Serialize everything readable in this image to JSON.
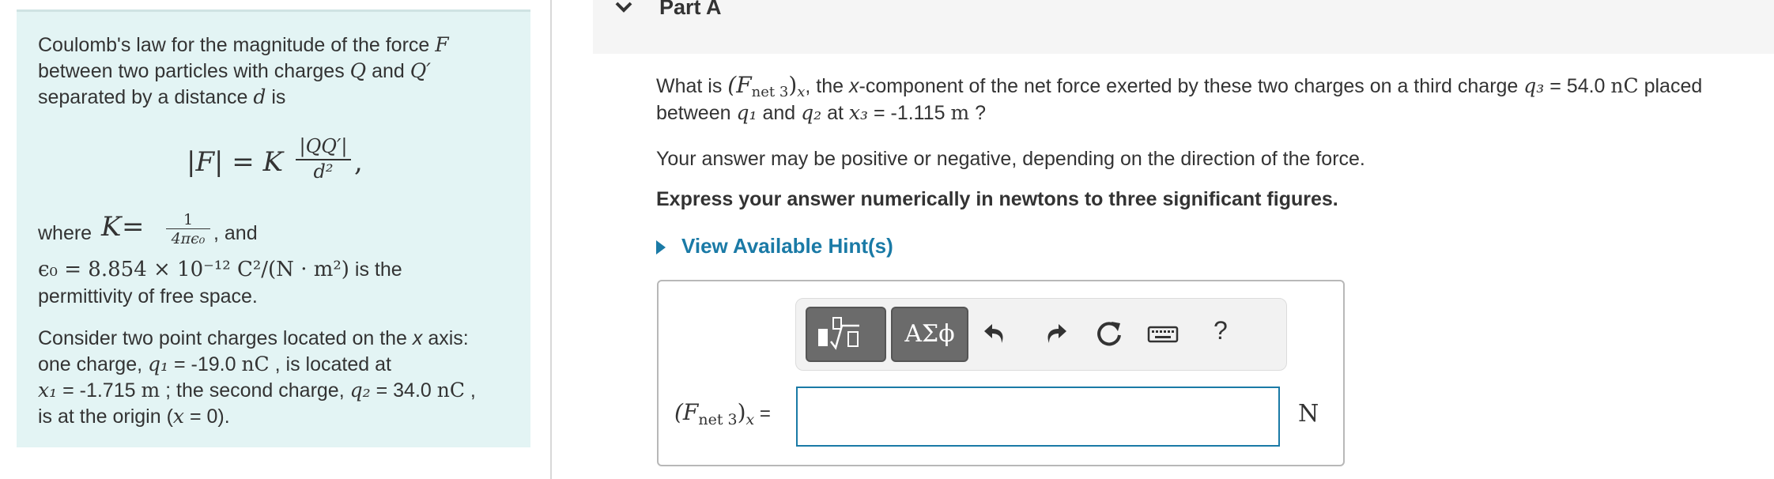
{
  "info": {
    "intro_1": "Coulomb's law for the magnitude of the force ",
    "intro_F": "F",
    "intro_2": "between two particles with charges ",
    "intro_Q": "Q",
    "intro_and": " and ",
    "intro_Qp": "Q′",
    "intro_3": "separated by a distance ",
    "intro_d": "d",
    "intro_is": " is",
    "formula_lhs": "|F| = K",
    "formula_num": "|QQ′|",
    "formula_den": "d²",
    "formula_comma": ",",
    "where": "where ",
    "K_sym": "K",
    "K_eq": " = ",
    "K_num": "1",
    "K_den": "4πϵ₀",
    "K_and": ", and",
    "eps_expr": "ϵ₀ = 8.854 × 10⁻¹² C²/(N · m²)",
    "eps_tail": " is the",
    "permittivity": "permittivity of free space.",
    "consider_1": "Consider two point charges located on the ",
    "consider_x": "x",
    "consider_axis": " axis:",
    "charge1_a": "one charge, ",
    "q1_sym": "q₁",
    "charge1_b": " = -19.0 ",
    "nC1": "nC",
    "charge1_c": " , is located at",
    "x1_sym": "x₁",
    "x1_val": " = -1.715 ",
    "m1": "m",
    "x1_tail": " ; the second charge, ",
    "q2_sym": "q₂",
    "q2_val": " = 34.0 ",
    "nC2": "nC",
    "q2_tail": " ,",
    "origin_a": "is at the origin (",
    "origin_x": "x",
    "origin_b": " = 0)."
  },
  "part": {
    "title": "Part A"
  },
  "question": {
    "q1_a": "What is ",
    "F_expr": "(F",
    "F_sub": "net 3",
    "F_close": ")",
    "F_x": "x",
    "q1_b": ", the ",
    "q1_x": "x",
    "q1_c": "-component of the net force exerted by these two charges on a third charge ",
    "q3_sym": "q₃",
    "q3_val": " = 54.0 ",
    "nC3": "nC",
    "q1_d": " placed",
    "q2_a": "between ",
    "q1s": "q₁",
    "q2_b": " and ",
    "q2s": "q₂",
    "q2_c": " at ",
    "x3_sym": "x₃",
    "x3_val": " = -1.115 ",
    "m3": "m",
    "q2_d": " ?",
    "sign_note": "Your answer may be positive or negative, depending on the direction of the force.",
    "instruction": "Express your answer numerically in newtons to three significant figures."
  },
  "hint": {
    "label": "View Available Hint(s)"
  },
  "toolbar": {
    "greek_label": "ΑΣϕ",
    "help_label": "?"
  },
  "answer": {
    "label_F": "(F",
    "label_sub": "net 3",
    "label_close": ")",
    "label_x": "x",
    "label_eq": " =",
    "value": "",
    "unit": "N"
  }
}
